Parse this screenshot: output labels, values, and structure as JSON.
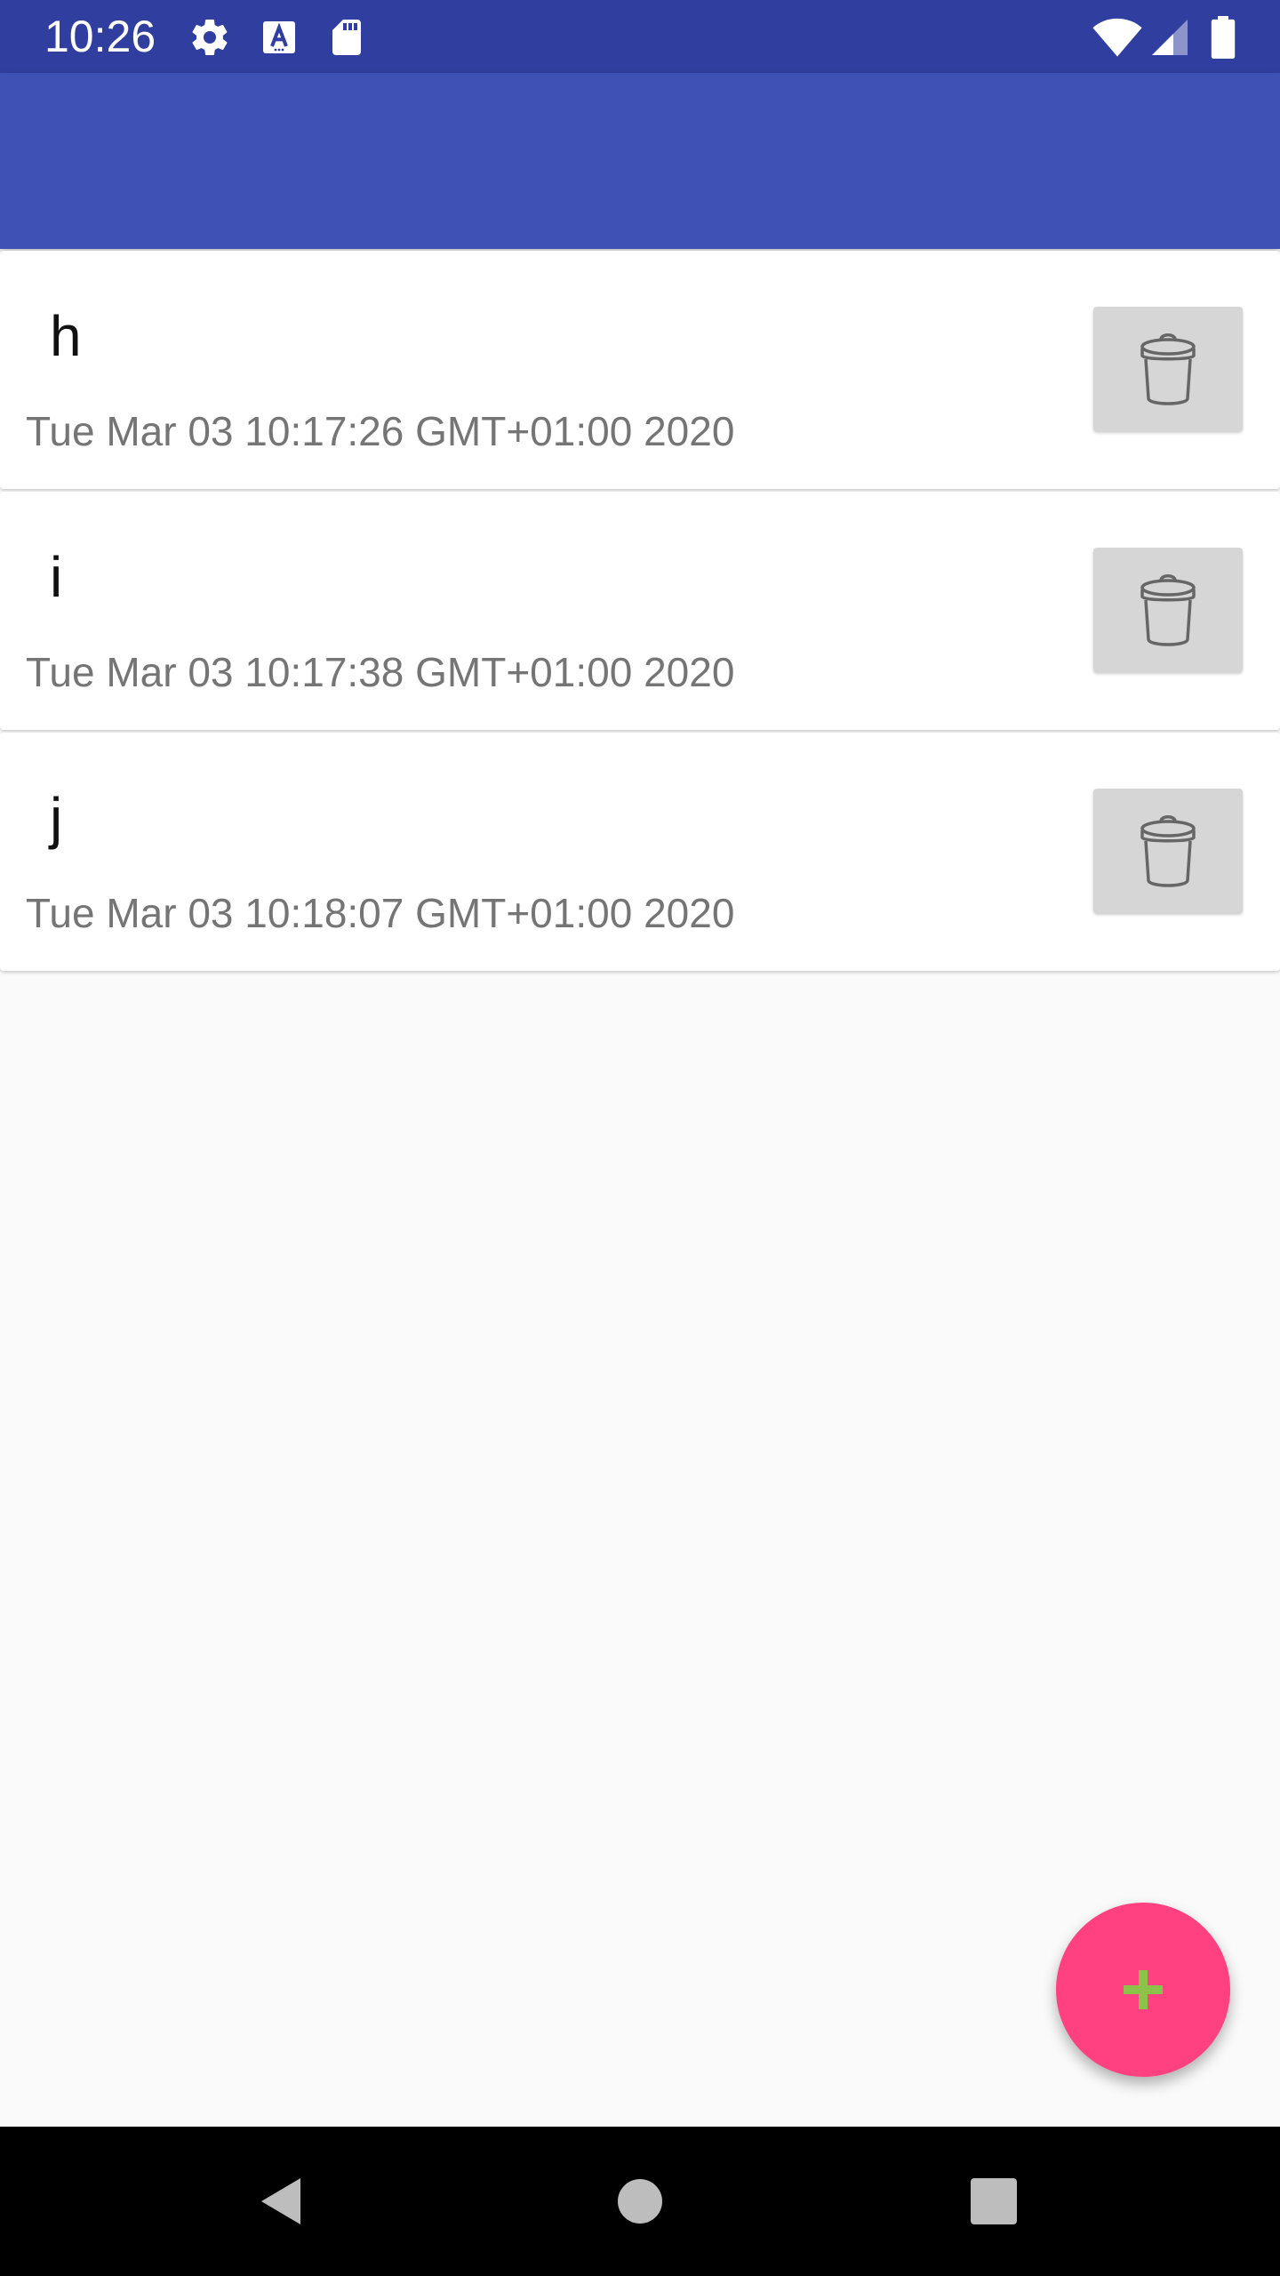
{
  "status_bar": {
    "time": "10:26",
    "icons": [
      "gear-icon",
      "text-a-icon",
      "sd-card-icon",
      "wifi-icon",
      "signal-icon",
      "battery-icon"
    ]
  },
  "colors": {
    "status_bar": "#303f9f",
    "app_bar": "#3f51b5",
    "fab": "#ff4081",
    "fab_icon": "#8bc34a",
    "delete_button": "#d6d6d6"
  },
  "list": {
    "items": [
      {
        "title": "h",
        "date": "Tue Mar 03 10:17:26 GMT+01:00 2020"
      },
      {
        "title": "i",
        "date": "Tue Mar 03 10:17:38 GMT+01:00 2020"
      },
      {
        "title": "j",
        "date": "Tue Mar 03 10:18:07 GMT+01:00 2020"
      }
    ]
  },
  "fab": {
    "icon": "plus-icon"
  },
  "nav_bar": {
    "icons": [
      "back-icon",
      "home-icon",
      "recents-icon"
    ]
  }
}
